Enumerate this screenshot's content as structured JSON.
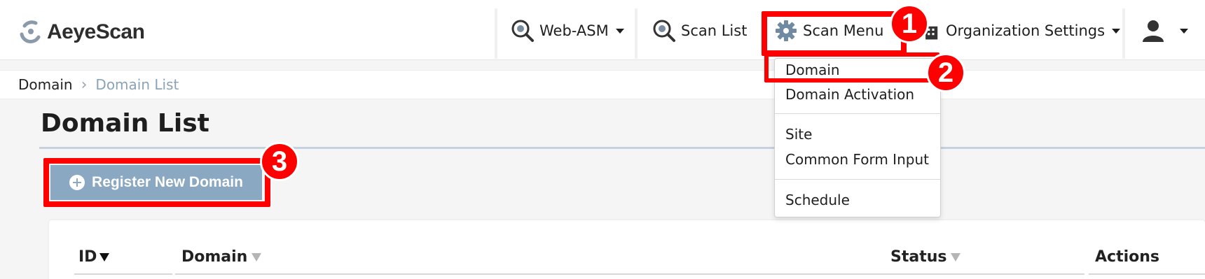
{
  "header": {
    "logo_text": "AeyeScan",
    "nav": [
      {
        "label": "Web-ASM",
        "icon": "magnifier-icon"
      },
      {
        "label": "Scan List",
        "icon": "magnifier-icon"
      },
      {
        "label": "Scan Menu",
        "icon": "gear-icon"
      },
      {
        "label": "Organization Settings",
        "icon": "building-icon"
      },
      {
        "label": "",
        "icon": "user-icon"
      }
    ]
  },
  "breadcrumb": {
    "root": "Domain",
    "current": "Domain List"
  },
  "page": {
    "title": "Domain List",
    "register_button": "Register New Domain"
  },
  "table": {
    "headers": [
      "ID",
      "Domain",
      "Status",
      "Actions"
    ]
  },
  "dropdown": {
    "items": [
      "Domain",
      "Domain Activation",
      "Site",
      "Common Form Input",
      "Schedule"
    ]
  },
  "callouts": [
    "1",
    "2",
    "3"
  ],
  "colors": {
    "accent": "#ff0000",
    "button": "#8aa8c2",
    "breadcrumb_current": "#8aa3b8"
  }
}
